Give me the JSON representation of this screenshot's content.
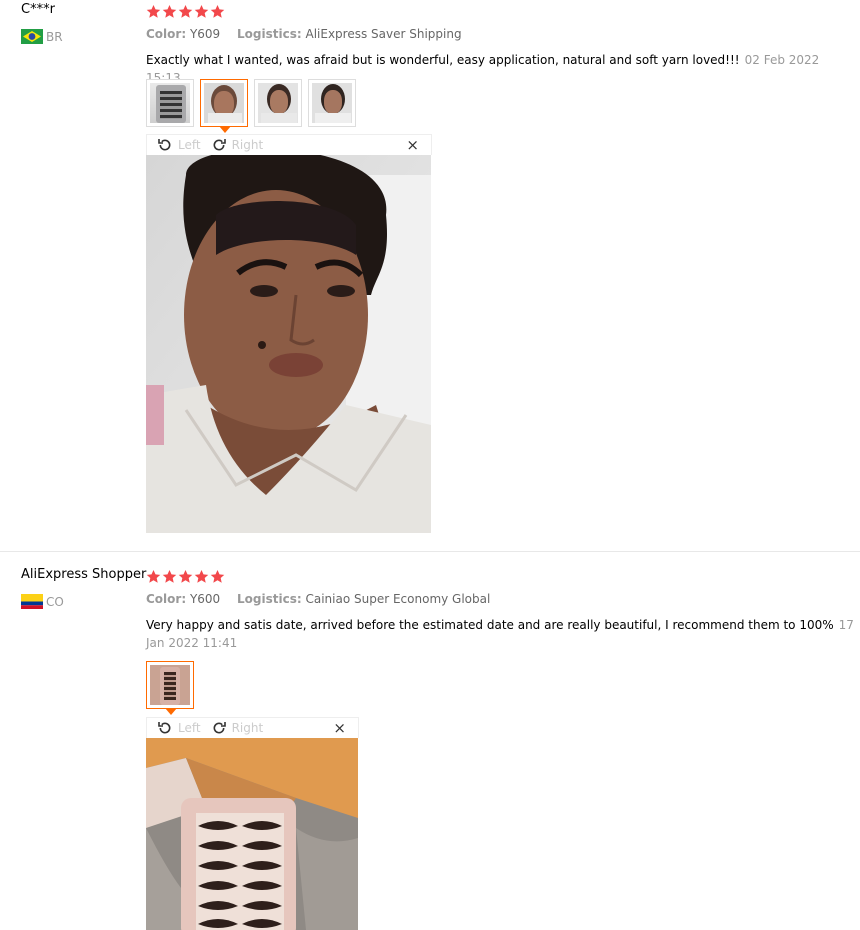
{
  "reviews": [
    {
      "user": "C***r",
      "country": "BR",
      "rating": 5,
      "color_label": "Color:",
      "color_value": "Y609",
      "logistics_label": "Logistics:",
      "logistics_value": "AliExpress Saver Shipping",
      "feedback": "Exactly what I wanted, was afraid but is wonderful, easy application, natural and soft yarn loved!!!",
      "date": "02 Feb 2022 15:13",
      "photo_count": 4,
      "viewer": {
        "left_label": "Left",
        "right_label": "Right",
        "close_label": "×"
      }
    },
    {
      "user": "AliExpress Shopper",
      "country": "CO",
      "rating": 5,
      "color_label": "Color:",
      "color_value": "Y600",
      "logistics_label": "Logistics:",
      "logistics_value": "Cainiao Super Economy Global",
      "feedback": "Very happy and satis date, arrived before the estimated date and are really beautiful, I recommend them to 100%",
      "date": "17 Jan 2022 11:41",
      "photo_count": 1,
      "viewer": {
        "left_label": "Left",
        "right_label": "Right",
        "close_label": "×"
      }
    }
  ],
  "colors": {
    "star": "#f2484b",
    "accent": "#ff6a00",
    "muted": "#999999"
  },
  "icons": [
    "star-icon",
    "brazil-flag-icon",
    "colombia-flag-icon",
    "rotate-left-icon",
    "rotate-right-icon",
    "close-icon"
  ]
}
